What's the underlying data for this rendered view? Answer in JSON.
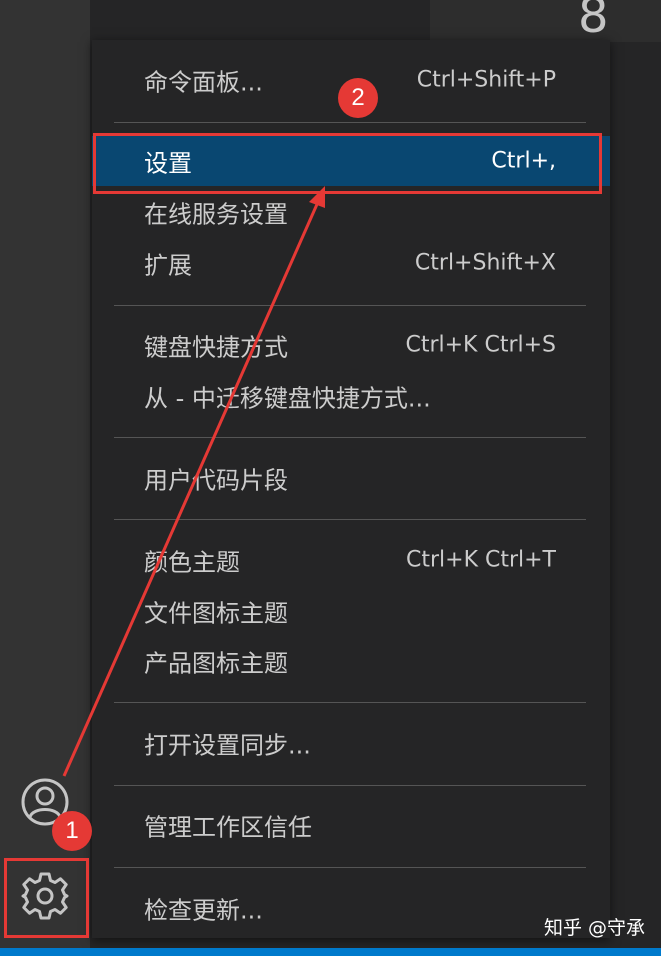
{
  "menu": {
    "items": [
      {
        "label": "命令面板...",
        "shortcut": "Ctrl+Shift+P"
      },
      {
        "label": "设置",
        "shortcut": "Ctrl+,"
      },
      {
        "label": "在线服务设置",
        "shortcut": ""
      },
      {
        "label": "扩展",
        "shortcut": "Ctrl+Shift+X"
      },
      {
        "label": "键盘快捷方式",
        "shortcut": "Ctrl+K Ctrl+S"
      },
      {
        "label": "从 - 中迁移键盘快捷方式...",
        "shortcut": ""
      },
      {
        "label": "用户代码片段",
        "shortcut": ""
      },
      {
        "label": "颜色主题",
        "shortcut": "Ctrl+K Ctrl+T"
      },
      {
        "label": "文件图标主题",
        "shortcut": ""
      },
      {
        "label": "产品图标主题",
        "shortcut": ""
      },
      {
        "label": "打开设置同步...",
        "shortcut": ""
      },
      {
        "label": "管理工作区信任",
        "shortcut": ""
      },
      {
        "label": "检查更新...",
        "shortcut": ""
      }
    ],
    "selected_item": "设置"
  },
  "activity_bar": {
    "icons": [
      "account-icon",
      "gear-icon"
    ]
  },
  "annotations": {
    "badge_1": "1",
    "badge_2": "2",
    "color": "#e53935"
  },
  "corner_digit": "8",
  "watermark": "知乎 @守承",
  "colors": {
    "menu_bg": "#252526",
    "selected_bg": "#094771",
    "activity_bar_bg": "#333333",
    "status_bar": "#007acc"
  }
}
